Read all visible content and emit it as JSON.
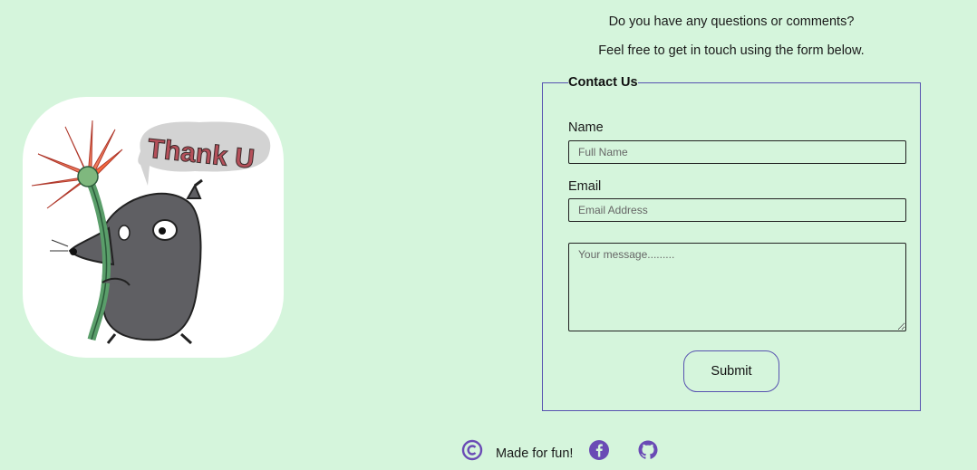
{
  "intro": {
    "line1": "Do you have any questions or comments?",
    "line2": "Feel free to get in touch using the form below."
  },
  "illustration": {
    "speech_text": "Thank U",
    "icon": "mouse-with-flower-illustration"
  },
  "form": {
    "legend": "Contact Us",
    "name_label": "Name",
    "name_placeholder": "Full Name",
    "name_value": "",
    "email_label": "Email",
    "email_placeholder": "Email Address",
    "email_value": "",
    "message_placeholder": "Your message.........",
    "message_value": "",
    "submit_label": "Submit"
  },
  "footer": {
    "text": "Made for fun!",
    "icons": [
      "copyright-icon",
      "facebook-icon",
      "github-icon"
    ]
  },
  "colors": {
    "background": "#d5f5dc",
    "accent": "#5752b0",
    "icon_purple": "#6a4bb5"
  }
}
